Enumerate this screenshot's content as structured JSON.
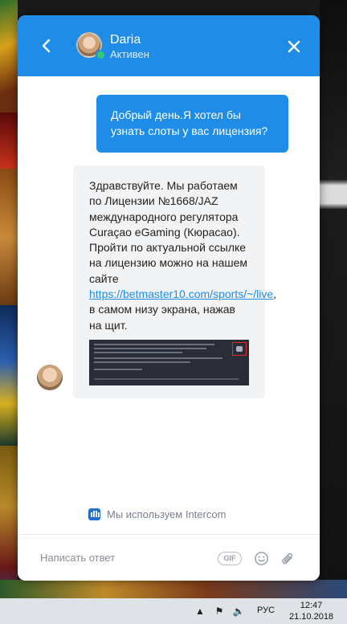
{
  "colors": {
    "accent": "#1f8de8",
    "online": "#37c871",
    "agent_bubble": "#f2f3f5"
  },
  "header": {
    "back_icon": "arrow-left-icon",
    "agent_name": "Daria",
    "agent_status": "Активен",
    "close_icon": "close-icon"
  },
  "messages": {
    "user_text": "Добрый день.Я хотел бы узнать слоты у вас лицензия?",
    "agent_text_before": "Здравствуйте. Мы работаем по Лицензии №1668/JAZ международного регулятора Curaçao eGaming (Кюрасао). Пройти по актуальной ссылке на лицензию можно на нашем сайте ",
    "agent_link": "https://betmaster10.com/sports/~/live",
    "agent_text_after": ", в самом низу экрана, нажав на щит."
  },
  "footer": {
    "powered_by": "Мы используем Intercom",
    "reply_placeholder": "Написать ответ",
    "gif_label": "GIF",
    "emoji_icon": "emoji-icon",
    "attach_icon": "paperclip-icon"
  },
  "taskbar": {
    "language": "РУС",
    "time": "12:47",
    "date": "21.10.2018"
  }
}
